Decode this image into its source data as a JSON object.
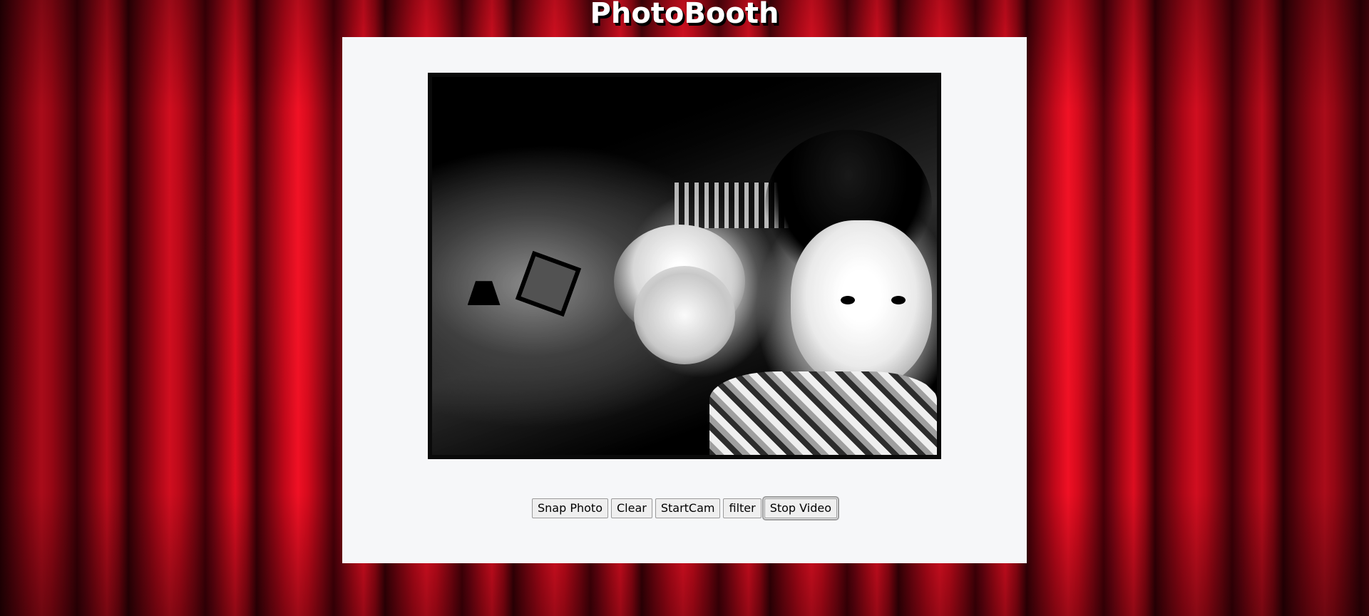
{
  "app": {
    "title": "PhotoBooth"
  },
  "photo": {
    "description_icon": "photo-preview-image"
  },
  "controls": {
    "buttons": [
      {
        "label": "Snap Photo"
      },
      {
        "label": "Clear"
      },
      {
        "label": "StartCam"
      },
      {
        "label": "filter"
      },
      {
        "label": "Stop Video",
        "focused": true
      }
    ]
  },
  "colors": {
    "curtain": "#d40a1c",
    "panel": "#f6f7f9",
    "title_text": "#ffffff"
  }
}
